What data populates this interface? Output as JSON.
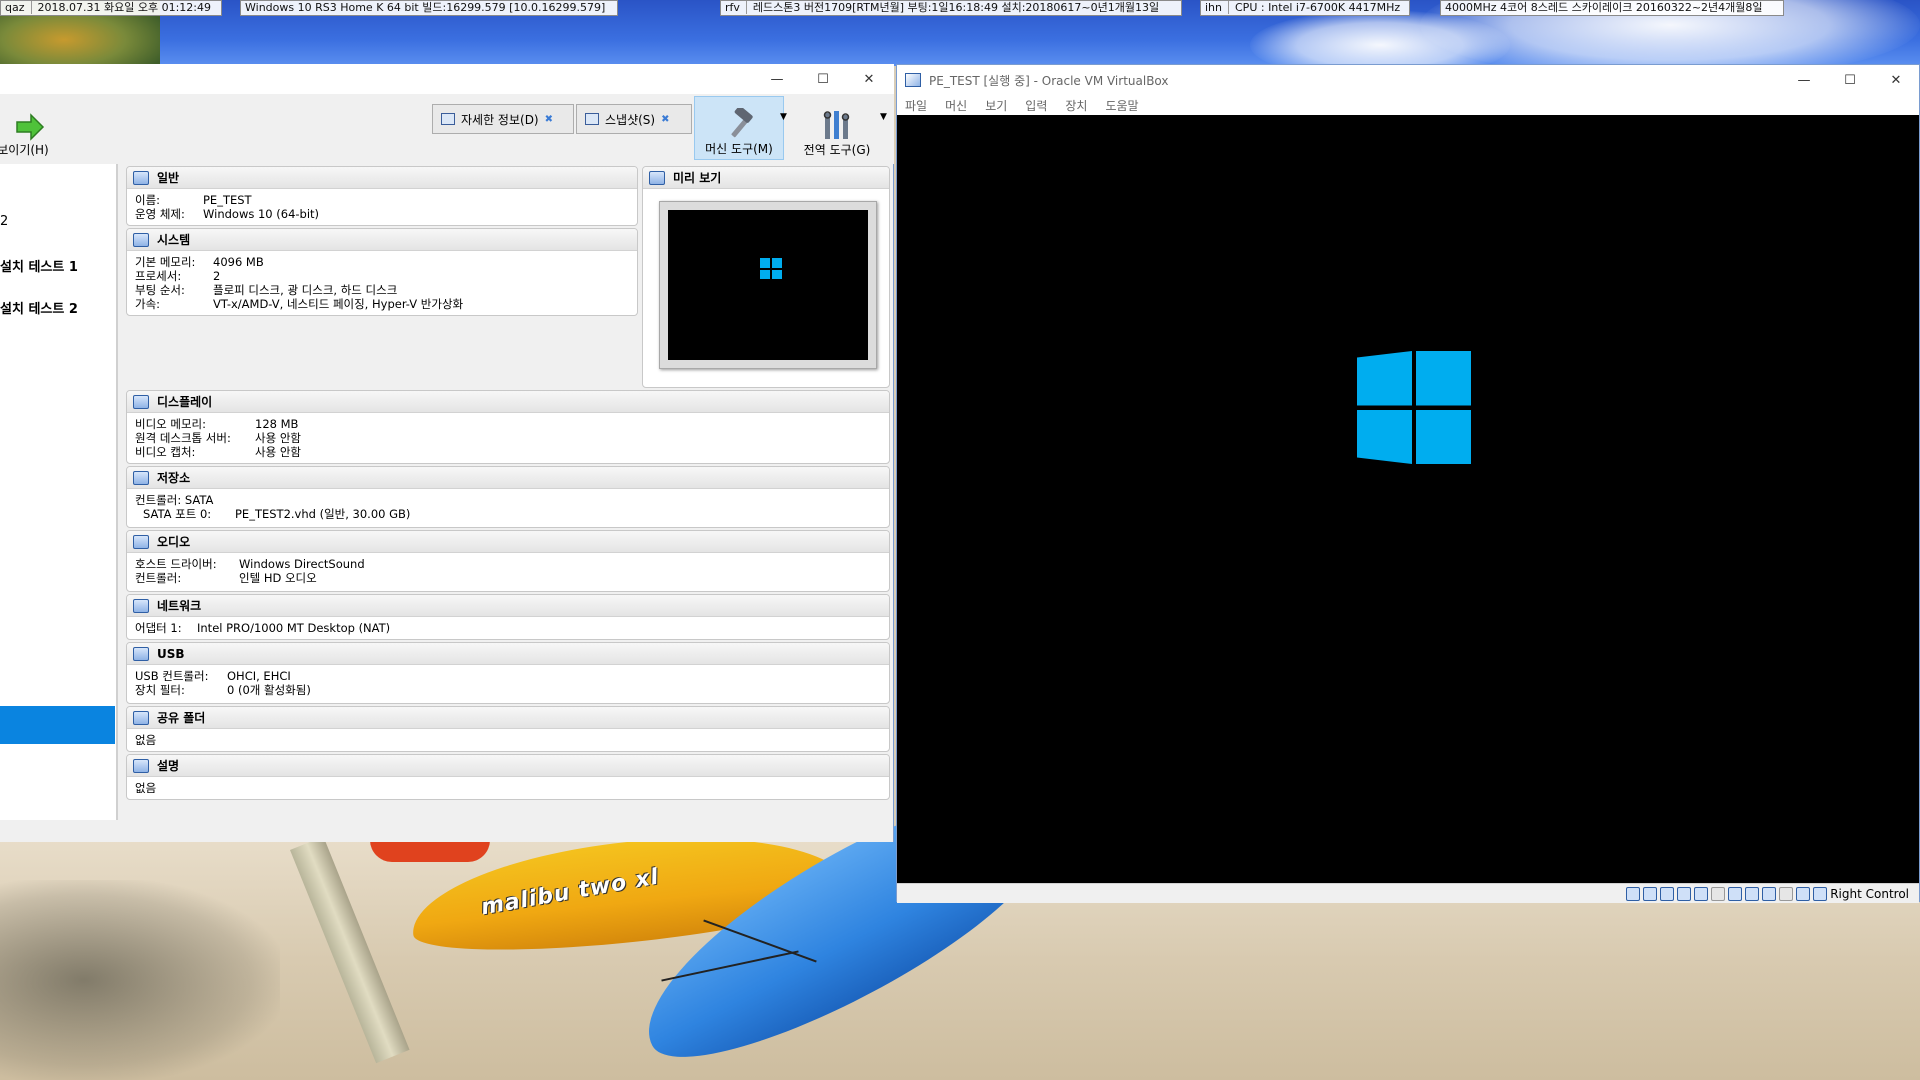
{
  "desktop": {
    "info": [
      {
        "key": "qaz",
        "value": "2018.07.31 화요일 오후 01:12:49"
      },
      {
        "value": "Windows 10 RS3 Home K 64 bit 빌드:16299.579 [10.0.16299.579]"
      },
      {
        "key": "rfv",
        "value": "레드스톤3 버전1709[RTM년월] 부팅:1일16:18:49 설치:20180617~0년1개월13일"
      },
      {
        "key": "ihn",
        "value": "CPU : Intel i7-6700K 4417MHz"
      },
      {
        "value": "4000MHz 4코어 8스레드 스카이레이크 20160322~2년4개월8일"
      }
    ],
    "kayak_text": "malibu two xl"
  },
  "manager": {
    "controls": {
      "minimize": "—",
      "maximize": "☐",
      "close": "✕"
    },
    "toolbar": {
      "show_label": "보이기(H)",
      "details_label": "자세한 정보(D)",
      "snapshots_label": "스냅샷(S)",
      "machine_tools_label": "머신 도구(M)",
      "global_tools_label": "전역 도구(G)"
    },
    "vm_list": {
      "item1": "2",
      "item2": "설치 테스트 1",
      "item3": "설치 테스트 2"
    },
    "general": {
      "title": "일반",
      "name_k": "이름:",
      "name_v": "PE_TEST",
      "os_k": "운영 체제:",
      "os_v": "Windows 10 (64-bit)"
    },
    "system": {
      "title": "시스템",
      "mem_k": "기본 메모리:",
      "mem_v": "4096 MB",
      "cpu_k": "프로세서:",
      "cpu_v": "2",
      "boot_k": "부팅 순서:",
      "boot_v": "플로피 디스크, 광 디스크, 하드 디스크",
      "accel_k": "가속:",
      "accel_v": "VT-x/AMD-V, 네스티드 페이징, Hyper-V 반가상화"
    },
    "preview": {
      "title": "미리 보기"
    },
    "display": {
      "title": "디스플레이",
      "vmem_k": "비디오 메모리:",
      "vmem_v": "128 MB",
      "rdp_k": "원격 데스크톱 서버:",
      "rdp_v": "사용 안함",
      "cap_k": "비디오 캡처:",
      "cap_v": "사용 안함"
    },
    "storage": {
      "title": "저장소",
      "ctrl": "컨트롤러: SATA",
      "port_k": "SATA 포트 0:",
      "port_v": "PE_TEST2.vhd (일반, 30.00 GB)"
    },
    "audio": {
      "title": "오디오",
      "host_k": "호스트 드라이버:",
      "host_v": "Windows DirectSound",
      "ctrl_k": "컨트롤러:",
      "ctrl_v": "인텔 HD 오디오"
    },
    "network": {
      "title": "네트워크",
      "adapter_k": "어댑터 1:",
      "adapter_v": "Intel PRO/1000 MT Desktop (NAT)"
    },
    "usb": {
      "title": "USB",
      "ctrl_k": "USB 컨트롤러:",
      "ctrl_v": "OHCI, EHCI",
      "filter_k": "장치 필터:",
      "filter_v": "0 (0개 활성화됨)"
    },
    "shared": {
      "title": "공유 폴더",
      "value": "없음"
    },
    "description": {
      "title": "설명",
      "value": "없음"
    }
  },
  "vm_window": {
    "title": "PE_TEST [실행 중] - Oracle VM VirtualBox",
    "menu": [
      "파일",
      "머신",
      "보기",
      "입력",
      "장치",
      "도움말"
    ],
    "host_key": "Right Control",
    "controls": {
      "minimize": "—",
      "maximize": "☐",
      "close": "✕"
    }
  },
  "colors": {
    "selection": "#0a84e0",
    "win_logo": "#00adef",
    "accent_border": "#7a9cd0"
  }
}
